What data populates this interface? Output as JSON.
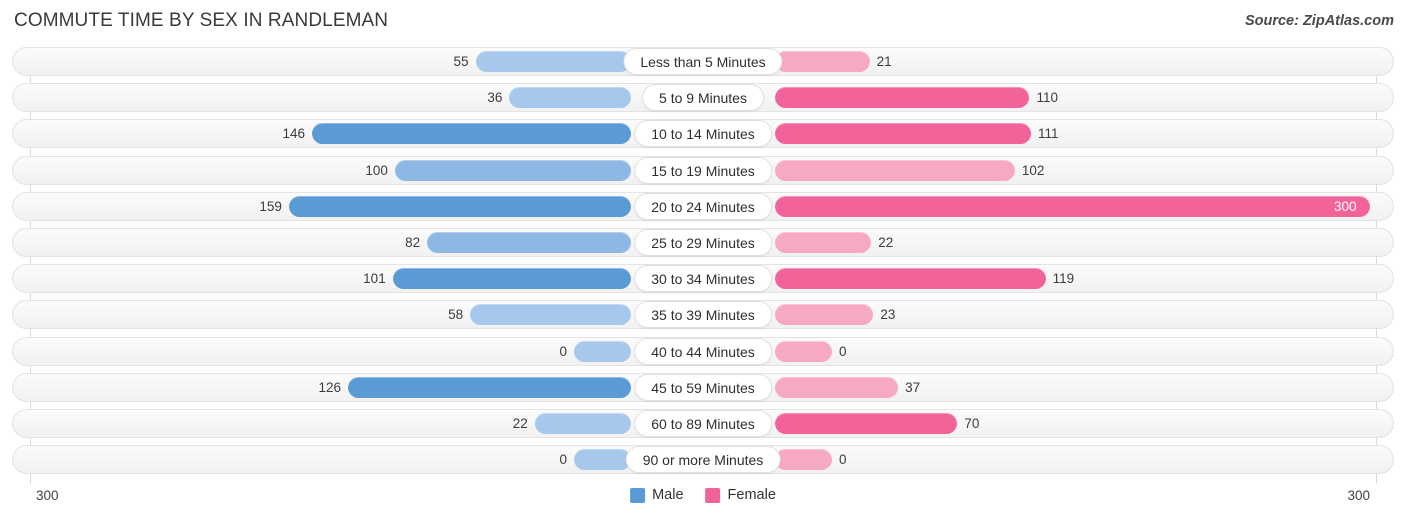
{
  "header": {
    "title": "COMMUTE TIME BY SEX IN RANDLEMAN",
    "source": "Source: ZipAtlas.com"
  },
  "legend": {
    "items": [
      {
        "label": "Male",
        "color": "#5B9BD5"
      },
      {
        "label": "Female",
        "color": "#F2639A"
      }
    ]
  },
  "axis": {
    "left_max": "300",
    "right_max": "300"
  },
  "chart_data": {
    "type": "bar",
    "orientation": "horizontal-diverging",
    "title": "COMMUTE TIME BY SEX IN RANDLEMAN",
    "subtitle": "",
    "xlabel": "",
    "ylabel": "",
    "xlim": [
      300,
      0,
      300
    ],
    "axis_max": 300,
    "grid": false,
    "legend_position": "bottom-center",
    "categories": [
      "Less than 5 Minutes",
      "5 to 9 Minutes",
      "10 to 14 Minutes",
      "15 to 19 Minutes",
      "20 to 24 Minutes",
      "25 to 29 Minutes",
      "30 to 34 Minutes",
      "35 to 39 Minutes",
      "40 to 44 Minutes",
      "45 to 59 Minutes",
      "60 to 89 Minutes",
      "90 or more Minutes"
    ],
    "series": [
      {
        "name": "Male",
        "color": "#5B9BD5",
        "values": [
          55,
          36,
          146,
          100,
          159,
          82,
          101,
          58,
          0,
          126,
          22,
          0
        ]
      },
      {
        "name": "Female",
        "color": "#F2639A",
        "values": [
          21,
          110,
          111,
          102,
          300,
          22,
          119,
          23,
          0,
          37,
          70,
          0
        ]
      }
    ]
  },
  "rows": [
    {
      "category": "Less than 5 Minutes",
      "male": "55",
      "female": "21",
      "male_pct": 18.3,
      "female_pct": 7.0,
      "male_shade": "light",
      "female_shade": "light"
    },
    {
      "category": "5 to 9 Minutes",
      "male": "36",
      "female": "110",
      "male_pct": 12.0,
      "female_pct": 36.7,
      "male_shade": "light",
      "female_shade": "dark"
    },
    {
      "category": "10 to 14 Minutes",
      "male": "146",
      "female": "111",
      "male_pct": 48.7,
      "female_pct": 37.0,
      "male_shade": "dark",
      "female_shade": "dark"
    },
    {
      "category": "15 to 19 Minutes",
      "male": "100",
      "female": "102",
      "male_pct": 33.3,
      "female_pct": 34.0,
      "male_shade": "mid",
      "female_shade": "light"
    },
    {
      "category": "20 to 24 Minutes",
      "male": "159",
      "female": "300",
      "male_pct": 53.0,
      "female_pct": 100.0,
      "male_shade": "dark",
      "female_shade": "dark"
    },
    {
      "category": "25 to 29 Minutes",
      "male": "82",
      "female": "22",
      "male_pct": 27.3,
      "female_pct": 7.3,
      "male_shade": "mid",
      "female_shade": "light"
    },
    {
      "category": "30 to 34 Minutes",
      "male": "101",
      "female": "119",
      "male_pct": 33.7,
      "female_pct": 39.7,
      "male_shade": "dark",
      "female_shade": "dark"
    },
    {
      "category": "35 to 39 Minutes",
      "male": "58",
      "female": "23",
      "male_pct": 19.3,
      "female_pct": 7.7,
      "male_shade": "light",
      "female_shade": "light"
    },
    {
      "category": "40 to 44 Minutes",
      "male": "0",
      "female": "0",
      "male_pct": 0.0,
      "female_pct": 0.0,
      "male_shade": "light",
      "female_shade": "light"
    },
    {
      "category": "45 to 59 Minutes",
      "male": "126",
      "female": "37",
      "male_pct": 42.0,
      "female_pct": 12.3,
      "male_shade": "dark",
      "female_shade": "light"
    },
    {
      "category": "60 to 89 Minutes",
      "male": "22",
      "female": "70",
      "male_pct": 7.3,
      "female_pct": 23.3,
      "male_shade": "light",
      "female_shade": "dark"
    },
    {
      "category": "90 or more Minutes",
      "male": "0",
      "female": "0",
      "male_pct": 0.0,
      "female_pct": 0.0,
      "male_shade": "light",
      "female_shade": "light"
    }
  ]
}
